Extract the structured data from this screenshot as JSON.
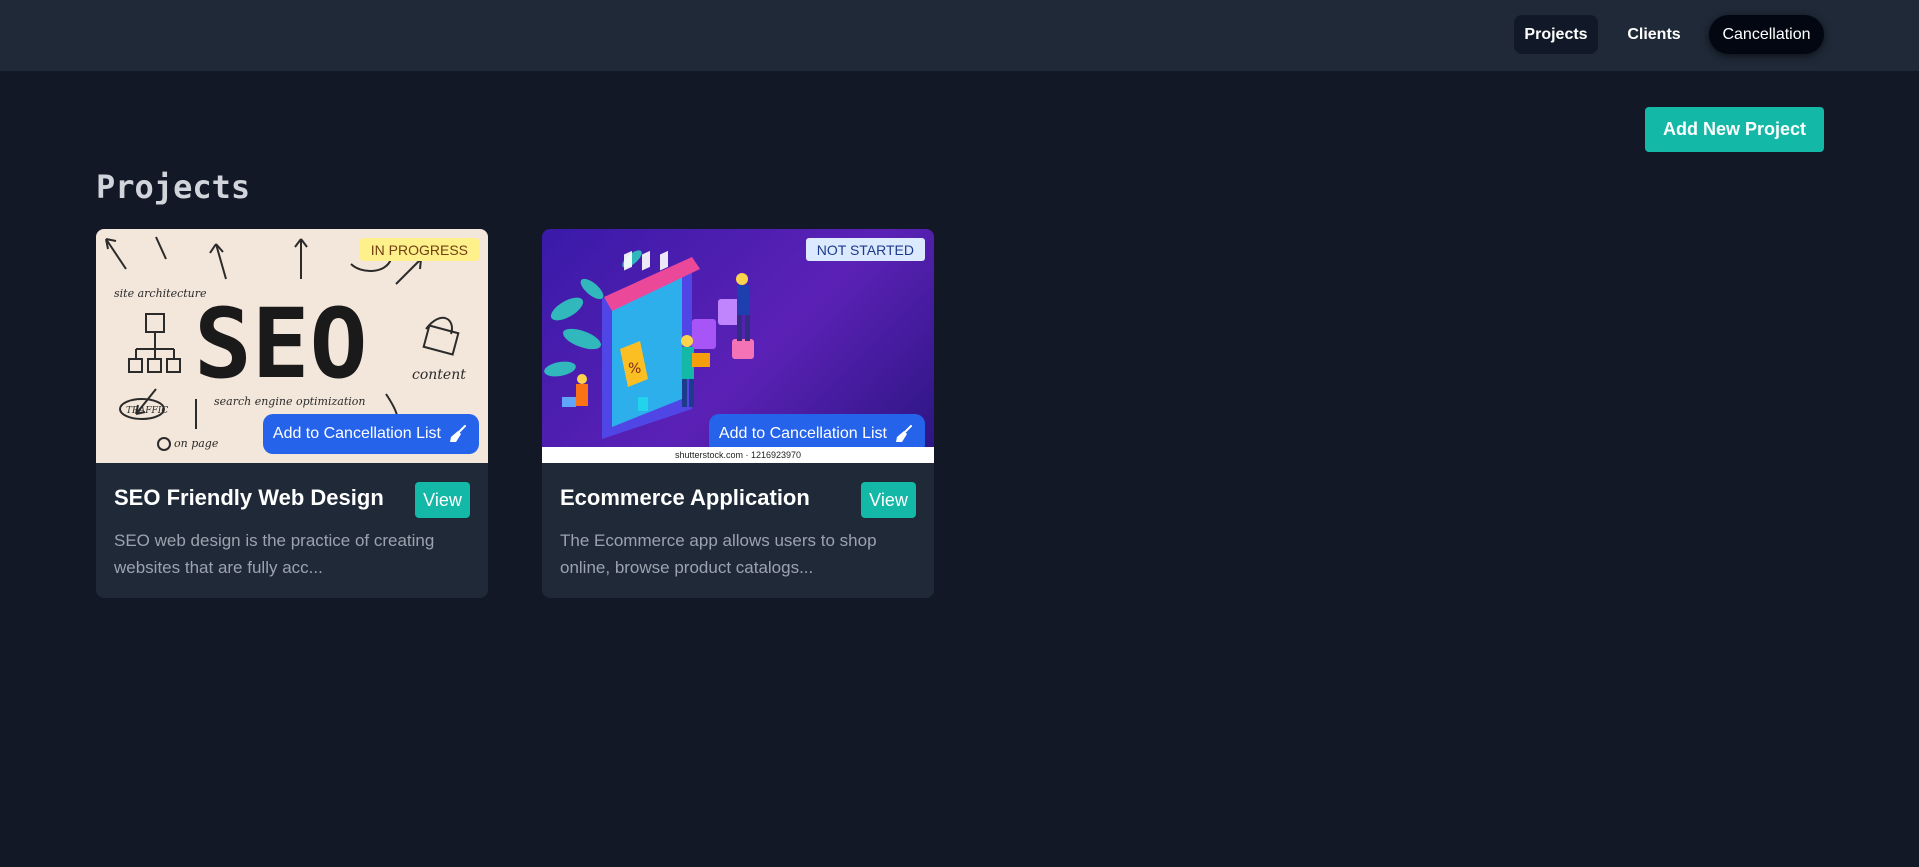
{
  "nav": {
    "projects_label": "Projects",
    "clients_label": "Clients",
    "cancellation_label": "Cancellation"
  },
  "main": {
    "add_project_label": "Add New Project",
    "title": "Projects"
  },
  "projects": [
    {
      "title": "SEO Friendly Web Design",
      "status": "IN PROGRESS",
      "description": "SEO web design is the practice of creating websites that are fully acc...",
      "cancel_label": "Add to Cancellation List",
      "view_label": "View",
      "image_text": "SEO",
      "image_words": [
        "site architecture",
        "content",
        "TRAFFIC",
        "search engine optimization",
        "on page"
      ]
    },
    {
      "title": "Ecommerce Application",
      "status": "NOT STARTED",
      "description": "The Ecommerce app allows users to shop online, browse product catalogs...",
      "cancel_label": "Add to Cancellation List",
      "view_label": "View",
      "watermark": "shutterstock.com · 1216923970"
    }
  ],
  "colors": {
    "background": "#121826",
    "navbar": "#1f2937",
    "card": "#1f2937",
    "teal": "#14b8a6",
    "blue": "#2563eb",
    "badge_progress": "#fef08a",
    "badge_not_started": "#dbeafe"
  },
  "icons": {
    "cancel_button_icon": "broom-icon"
  }
}
